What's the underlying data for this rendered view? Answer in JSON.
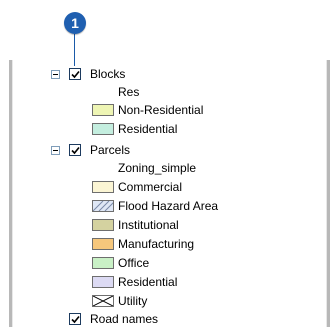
{
  "callout": {
    "number": "1"
  },
  "toc": {
    "layers": [
      {
        "name": "Blocks",
        "checked": true,
        "expanded": true,
        "field": "Res",
        "classes": [
          {
            "label": "Non-Residential",
            "color": "#eef5b4"
          },
          {
            "label": "Residential",
            "color": "#c4eedf"
          }
        ]
      },
      {
        "name": "Parcels",
        "checked": true,
        "expanded": true,
        "field": "Zoning_simple",
        "classes": [
          {
            "label": "Commercial",
            "color": "#fbf5d4"
          },
          {
            "label": "Flood Hazard Area",
            "color": "#dfe7f5",
            "pattern": "hatch"
          },
          {
            "label": "Institutional",
            "color": "#d4d2a0"
          },
          {
            "label": "Manufacturing",
            "color": "#f6c77c"
          },
          {
            "label": "Office",
            "color": "#c9f1c6"
          },
          {
            "label": "Residential",
            "color": "#dcdaf3"
          },
          {
            "label": "Utility",
            "color": "#ffffff",
            "pattern": "cross"
          }
        ]
      },
      {
        "name": "Road names",
        "checked": true,
        "expanded": false
      }
    ]
  }
}
